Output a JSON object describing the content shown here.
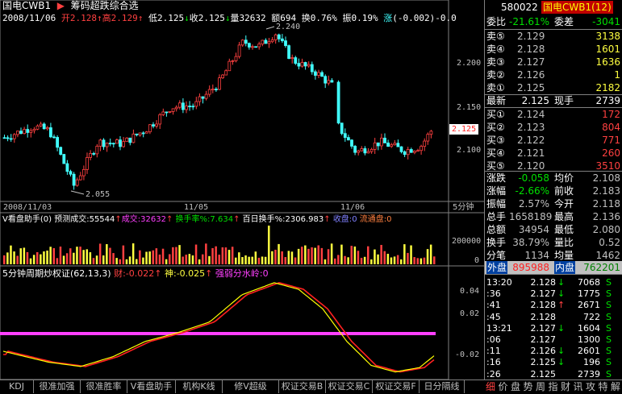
{
  "header": {
    "stock_name": "国电CWB1",
    "index_label": "筹码超跌综合选",
    "date": "2008/11/06",
    "open_label": "开",
    "open": "2.128",
    "high_label": "高",
    "high": "2.129",
    "low_label": "低",
    "low": "2.125",
    "close_label": "收",
    "close": "2.125",
    "vol_label": "量",
    "vol": "32632",
    "amt_label": "额",
    "amt": "694",
    "turn_label": "换",
    "turn": "0.76%",
    "amp_label": "振",
    "amp": "0.19%",
    "chg_label": "涨",
    "chg": "(-0.002)-0.0"
  },
  "main_chart": {
    "price_ticks": [
      "2.200",
      "2.150",
      "2.100"
    ],
    "current_price": "2.125",
    "high_marker": "2.240",
    "low_marker": "2.055",
    "dates": [
      "2008/11/03",
      "11/05",
      "11/06"
    ],
    "period": "5分钟"
  },
  "volume_panel": {
    "title": "V看盘助手(0)",
    "pred_label": "预测成交:",
    "pred": "55544",
    "trade_label": "成交:",
    "trade": "32632",
    "turn_label": "换手率%:",
    "turn": "7.634",
    "hundred_label": "百日换手%:",
    "hundred": "2306.983",
    "recv_label": "收盘:",
    "recv": "0",
    "flow_label": "流通盘:",
    "flow": "0",
    "tick": "200000",
    "tick_zero": "0"
  },
  "osc_panel": {
    "title": "5分钟周期炒权证(62,13,3)",
    "cai_label": "财:",
    "cai": "-0.022",
    "shen_label": "神:",
    "shen": "-0.025",
    "strong_label": "强弱分水岭:",
    "strong": "0",
    "ticks": [
      "0.04",
      "0.02",
      "-0.02"
    ]
  },
  "quote": {
    "weibi_label": "委比",
    "weibi": "-21.61%",
    "weicha_label": "委差",
    "weicha": "-3041",
    "code": "580022",
    "name": "国电CWB1(12)",
    "asks": [
      {
        "label": "卖⑤",
        "price": "2.129",
        "vol": "3138"
      },
      {
        "label": "卖④",
        "price": "2.128",
        "vol": "1601"
      },
      {
        "label": "卖③",
        "price": "2.127",
        "vol": "1636"
      },
      {
        "label": "卖②",
        "price": "2.126",
        "vol": "1"
      },
      {
        "label": "卖①",
        "price": "2.125",
        "vol": "2182"
      }
    ],
    "latest_label": "最新",
    "latest": "2.125",
    "now_label": "现手",
    "now": "2739",
    "bids": [
      {
        "label": "买①",
        "price": "2.124",
        "vol": "172"
      },
      {
        "label": "买②",
        "price": "2.123",
        "vol": "804"
      },
      {
        "label": "买③",
        "price": "2.122",
        "vol": "771"
      },
      {
        "label": "买④",
        "price": "2.121",
        "vol": "260"
      },
      {
        "label": "买⑤",
        "price": "2.120",
        "vol": "3510"
      }
    ],
    "stats": [
      {
        "l1": "涨跌",
        "v1": "-0.058",
        "l2": "均价",
        "v2": "2.108"
      },
      {
        "l1": "涨幅",
        "v1": "-2.66%",
        "l2": "前收",
        "v2": "2.183"
      },
      {
        "l1": "振幅",
        "v1": "2.57%",
        "l2": "今开",
        "v2": "2.118"
      },
      {
        "l1": "总手",
        "v1": "1658189",
        "l2": "最高",
        "v2": "2.136"
      },
      {
        "l1": "总额",
        "v1": "34954",
        "l2": "最低",
        "v2": "2.080"
      },
      {
        "l1": "换手",
        "v1": "38.79%",
        "l2": "量比",
        "v2": "0.52"
      },
      {
        "l1": "分笔",
        "v1": "1134",
        "l2": "均量",
        "v2": "1462"
      }
    ],
    "outer_label": "外盘",
    "outer": "895988",
    "inner_label": "内盘",
    "inner": "762201",
    "ticks": [
      {
        "time": "13:20",
        "price": "2.128",
        "dir": "↓",
        "vol": "7068",
        "bs": "S"
      },
      {
        "time": ":36",
        "price": "2.127",
        "dir": "↓",
        "vol": "1775",
        "bs": "S"
      },
      {
        "time": ":41",
        "price": "2.128",
        "dir": "↑",
        "vol": "2671",
        "bs": "S"
      },
      {
        "time": ":45",
        "price": "2.128",
        "dir": "",
        "vol": "722",
        "bs": "S"
      },
      {
        "time": "13:21",
        "price": "2.127",
        "dir": "↓",
        "vol": "1604",
        "bs": "S"
      },
      {
        "time": ":06",
        "price": "2.127",
        "dir": "",
        "vol": "1300",
        "bs": "S"
      },
      {
        "time": ":11",
        "price": "2.126",
        "dir": "↓",
        "vol": "2601",
        "bs": "S"
      },
      {
        "time": ":16",
        "price": "2.125",
        "dir": "↓",
        "vol": "196",
        "bs": "S"
      },
      {
        "time": ":26",
        "price": "2.125",
        "dir": "",
        "vol": "2739",
        "bs": "S"
      }
    ]
  },
  "tabs": [
    "KDJ",
    "很准加强",
    "很准胜率",
    "V看盘助手",
    "机构K线",
    "修V超级MACD",
    "权证交易B",
    "权证交易C",
    "权证交易F",
    "日分隔线"
  ],
  "right_tabs": [
    "细",
    "价",
    "盘",
    "势",
    "周",
    "指",
    "财",
    "讯",
    "攻",
    "特",
    "解"
  ],
  "colors": {
    "up": "#ff4040",
    "down": "#40ffff",
    "vol": "#ffff40",
    "threshold": "#ff40ff",
    "shen": "#ff2020",
    "cai": "#ffff00"
  }
}
